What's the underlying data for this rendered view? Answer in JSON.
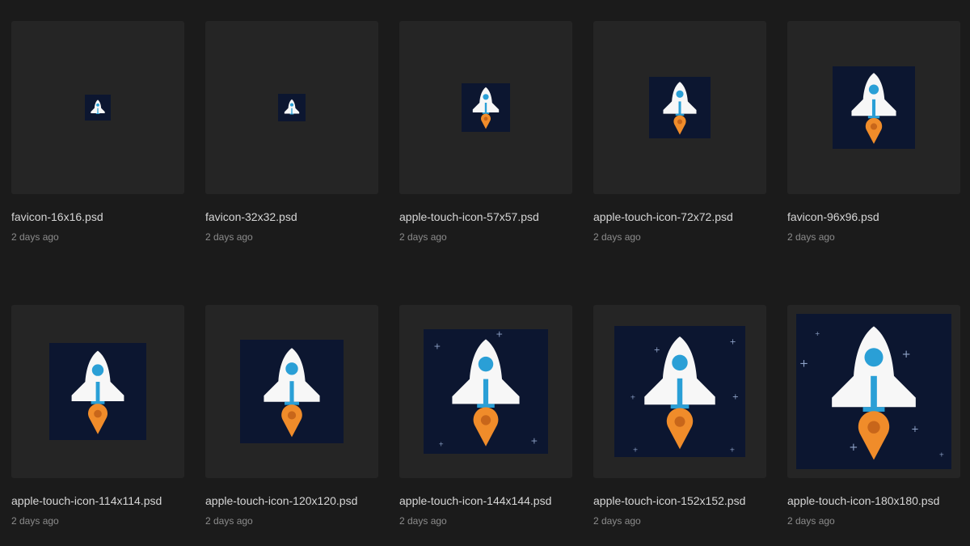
{
  "colors": {
    "background": "#1b1b1b",
    "thumbnail": "#252525",
    "icon_background": "#0c1630",
    "rocket_body": "#f7f7f7",
    "rocket_window": "#2a9fd6",
    "flame": "#f08c2a"
  },
  "files": [
    {
      "name": "favicon-16x16.psd",
      "modified": "2 days ago",
      "stars": false
    },
    {
      "name": "favicon-32x32.psd",
      "modified": "2 days ago",
      "stars": false
    },
    {
      "name": "apple-touch-icon-57x57.psd",
      "modified": "2 days ago",
      "stars": false
    },
    {
      "name": "apple-touch-icon-72x72.psd",
      "modified": "2 days ago",
      "stars": false
    },
    {
      "name": "favicon-96x96.psd",
      "modified": "2 days ago",
      "stars": false
    },
    {
      "name": "apple-touch-icon-114x114.psd",
      "modified": "2 days ago",
      "stars": false
    },
    {
      "name": "apple-touch-icon-120x120.psd",
      "modified": "2 days ago",
      "stars": false
    },
    {
      "name": "apple-touch-icon-144x144.psd",
      "modified": "2 days ago",
      "stars": true
    },
    {
      "name": "apple-touch-icon-152x152.psd",
      "modified": "2 days ago",
      "stars": true
    },
    {
      "name": "apple-touch-icon-180x180.psd",
      "modified": "2 days ago",
      "stars": true
    }
  ]
}
